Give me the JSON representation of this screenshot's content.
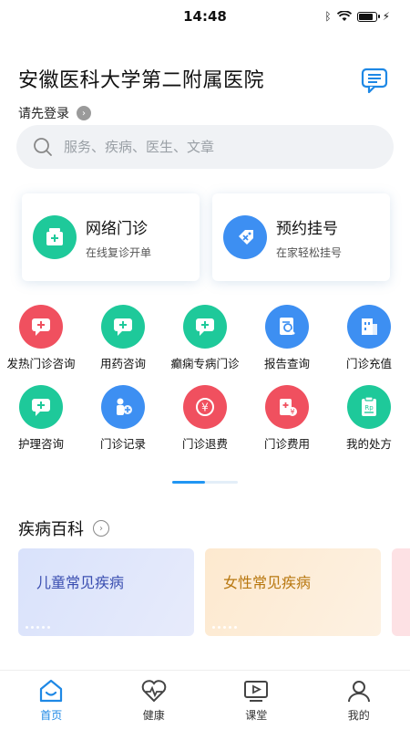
{
  "status": {
    "time": "14:48"
  },
  "header": {
    "title": "安徽医科大学第二附属医院",
    "login": "请先登录"
  },
  "search": {
    "placeholder": "服务、疾病、医生、文章"
  },
  "big_cards": [
    {
      "title": "网络门诊",
      "sub": "在线复诊开单",
      "icon": "clinic-icon",
      "color": "#1ec99a"
    },
    {
      "title": "预约挂号",
      "sub": "在家轻松挂号",
      "icon": "ticket-icon",
      "color": "#3d8ff2"
    }
  ],
  "services_row1": [
    {
      "label": "发热门诊咨询",
      "icon": "fever-chat-icon",
      "color": "#f0505f"
    },
    {
      "label": "用药咨询",
      "icon": "medicine-chat-icon",
      "color": "#1ec99a"
    },
    {
      "label": "癫痫专病门诊",
      "icon": "epilepsy-clinic-icon",
      "color": "#1ec99a"
    },
    {
      "label": "报告查询",
      "icon": "report-search-icon",
      "color": "#3d8ff2"
    },
    {
      "label": "门诊充值",
      "icon": "recharge-icon",
      "color": "#3d8ff2"
    }
  ],
  "services_row2": [
    {
      "label": "护理咨询",
      "icon": "nursing-chat-icon",
      "color": "#1ec99a"
    },
    {
      "label": "门诊记录",
      "icon": "record-icon",
      "color": "#3d8ff2"
    },
    {
      "label": "门诊退费",
      "icon": "refund-icon",
      "color": "#f0505f"
    },
    {
      "label": "门诊费用",
      "icon": "fee-icon",
      "color": "#f0505f"
    },
    {
      "label": "我的处方",
      "icon": "prescription-icon",
      "color": "#1ec99a"
    }
  ],
  "section": {
    "title": "疾病百科"
  },
  "disease_cards": [
    {
      "title": "儿童常见疾病"
    },
    {
      "title": "女性常见疾病"
    }
  ],
  "tabs": [
    {
      "label": "首页",
      "icon": "home-icon",
      "active": true
    },
    {
      "label": "健康",
      "icon": "heartbeat-icon",
      "active": false
    },
    {
      "label": "课堂",
      "icon": "video-icon",
      "active": false
    },
    {
      "label": "我的",
      "icon": "user-icon",
      "active": false
    }
  ],
  "colors": {
    "accent": "#1e88e5",
    "green": "#1ec99a",
    "red": "#f0505f",
    "blue": "#3d8ff2"
  }
}
